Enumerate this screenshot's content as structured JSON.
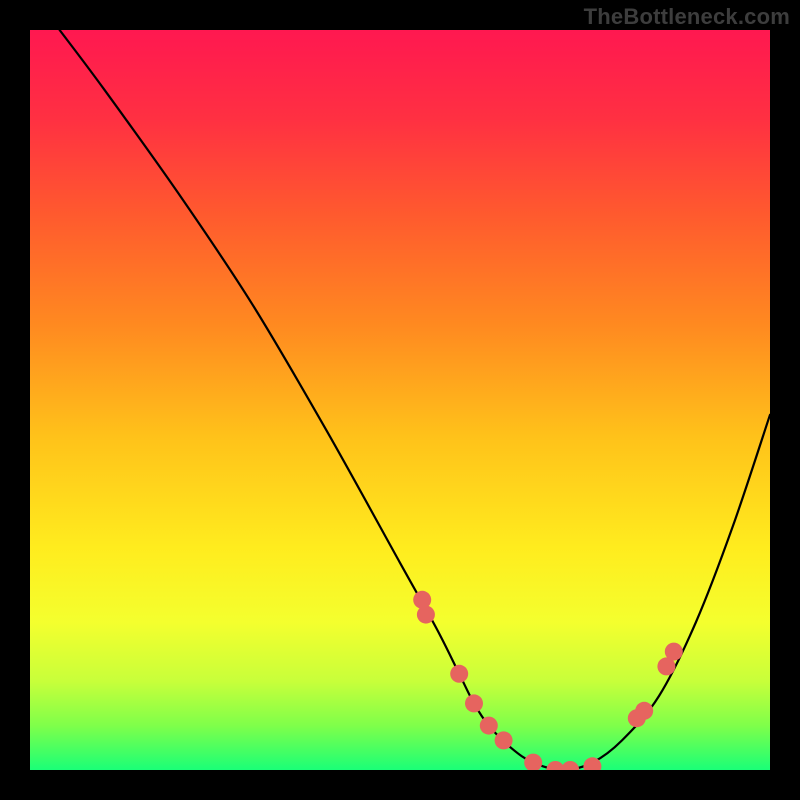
{
  "watermark": "TheBottleneck.com",
  "gradient": {
    "stops": [
      {
        "offset": 0.0,
        "color": "#ff1850"
      },
      {
        "offset": 0.12,
        "color": "#ff3042"
      },
      {
        "offset": 0.25,
        "color": "#ff5a2e"
      },
      {
        "offset": 0.4,
        "color": "#ff8a20"
      },
      {
        "offset": 0.55,
        "color": "#ffc21a"
      },
      {
        "offset": 0.7,
        "color": "#ffec1e"
      },
      {
        "offset": 0.8,
        "color": "#f4ff2e"
      },
      {
        "offset": 0.88,
        "color": "#c8ff3a"
      },
      {
        "offset": 0.94,
        "color": "#7fff4a"
      },
      {
        "offset": 1.0,
        "color": "#1aff77"
      }
    ]
  },
  "chart_data": {
    "type": "line",
    "title": "",
    "xlabel": "",
    "ylabel": "",
    "xlim": [
      0,
      100
    ],
    "ylim": [
      0,
      100
    ],
    "grid": false,
    "series": [
      {
        "name": "curve",
        "x": [
          4,
          10,
          20,
          30,
          40,
          50,
          55,
          58,
          60,
          62,
          65,
          68,
          72,
          76,
          80,
          85,
          90,
          95,
          100
        ],
        "y": [
          100,
          92,
          78,
          63,
          46,
          28,
          19,
          13,
          9,
          6,
          3,
          1,
          0,
          1,
          4,
          10,
          20,
          33,
          48
        ]
      }
    ],
    "markers": {
      "name": "dots",
      "color": "#e6645f",
      "radius": 9,
      "x": [
        53,
        53.5,
        58,
        60,
        62,
        64,
        68,
        71,
        73,
        76,
        82,
        83,
        86,
        87
      ],
      "y": [
        23,
        21,
        13,
        9,
        6,
        4,
        1,
        0,
        0,
        0.5,
        7,
        8,
        14,
        16
      ]
    }
  }
}
